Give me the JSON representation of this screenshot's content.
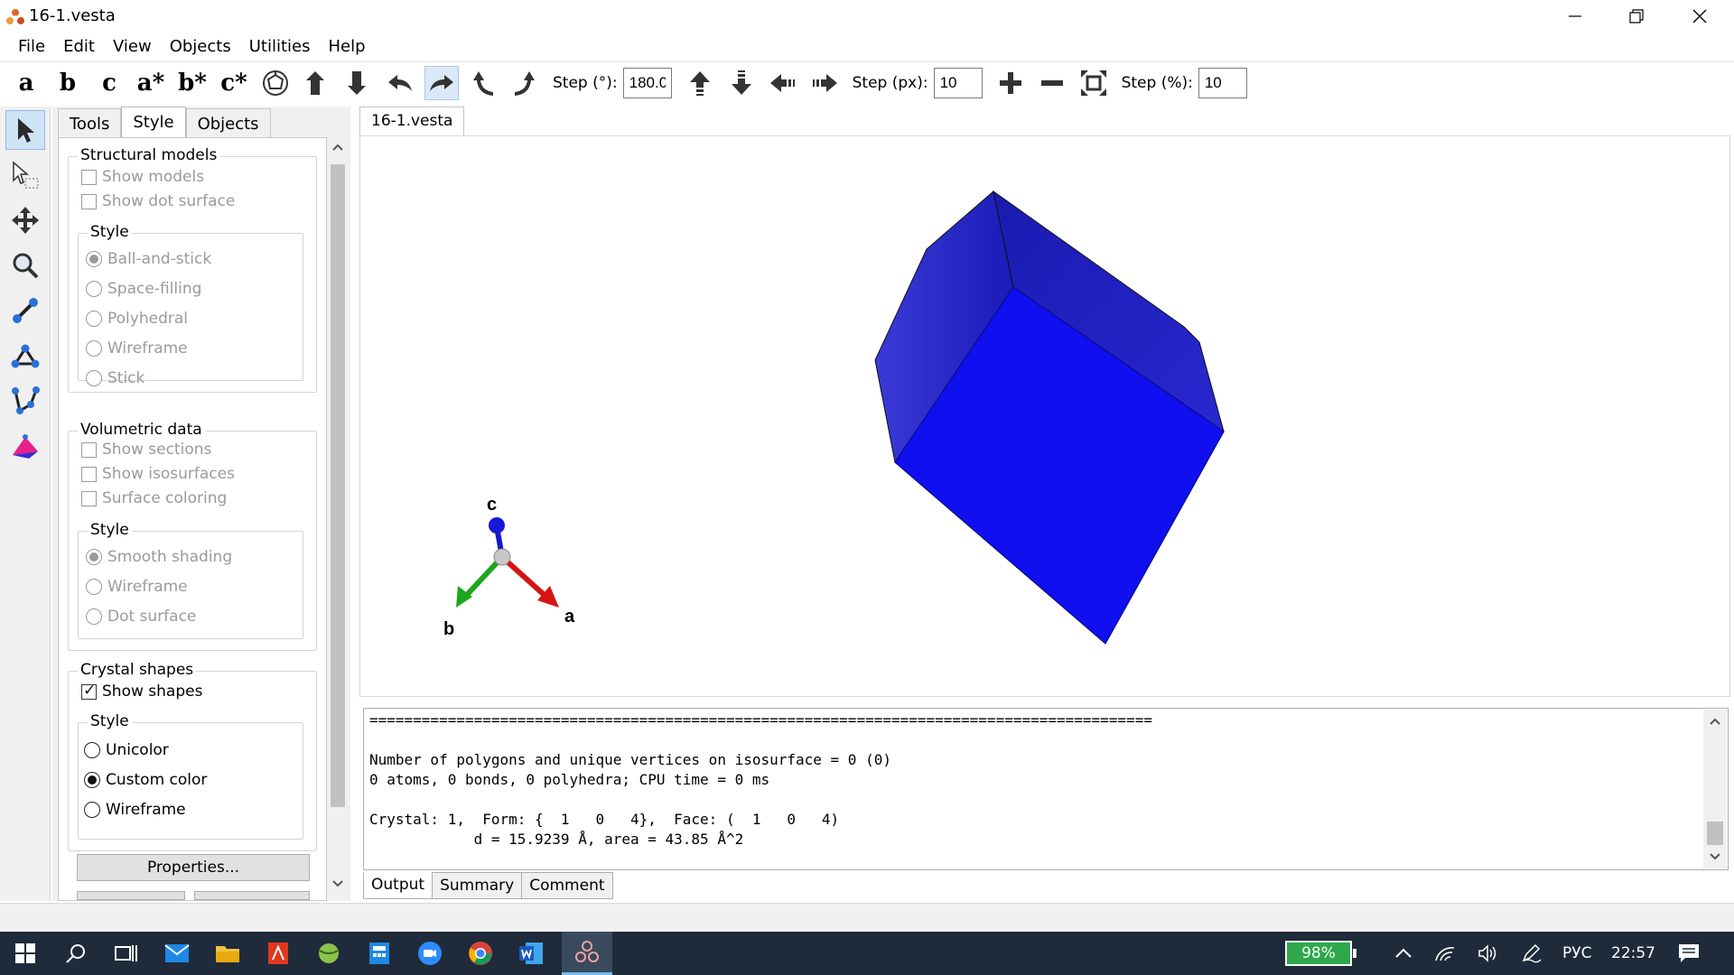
{
  "window": {
    "title": "16-1.vesta"
  },
  "menu": [
    "File",
    "Edit",
    "View",
    "Objects",
    "Utilities",
    "Help"
  ],
  "toolbar": {
    "axis_buttons": [
      "a",
      "b",
      "c",
      "a*",
      "b*",
      "c*"
    ],
    "step_deg_label": "Step (°):",
    "step_deg_value": "180.0",
    "step_px_label": "Step (px):",
    "step_px_value": "10",
    "step_pct_label": "Step (%):",
    "step_pct_value": "10"
  },
  "sidepanel": {
    "tabs": [
      "Tools",
      "Style",
      "Objects"
    ],
    "selected_tab": "Style",
    "structural": {
      "title": "Structural models",
      "show_models": "Show models",
      "show_dot_surface": "Show dot surface",
      "style_title": "Style",
      "options": [
        "Ball-and-stick",
        "Space-filling",
        "Polyhedral",
        "Wireframe",
        "Stick"
      ]
    },
    "volumetric": {
      "title": "Volumetric data",
      "show_sections": "Show sections",
      "show_isosurfaces": "Show isosurfaces",
      "surface_coloring": "Surface coloring",
      "style_title": "Style",
      "options": [
        "Smooth shading",
        "Wireframe",
        "Dot surface"
      ]
    },
    "crystal": {
      "title": "Crystal shapes",
      "show_shapes": "Show shapes",
      "style_title": "Style",
      "options": [
        "Unicolor",
        "Custom color",
        "Wireframe"
      ]
    },
    "properties_button": "Properties..."
  },
  "viewer": {
    "tab_label": "16-1.vesta",
    "axes": {
      "a": "a",
      "b": "b",
      "c": "c"
    },
    "shape_color": "#1414e6"
  },
  "output": {
    "separator": "==========================================================================================",
    "lines": [
      "Number of polygons and unique vertices on isosurface = 0 (0)",
      "0 atoms, 0 bonds, 0 polyhedra; CPU time = 0 ms",
      "",
      "Crystal: 1,  Form: {  1   0   4},  Face: (  1   0   4)",
      "            d = 15.9239 Å, area = 43.85 Å^2"
    ],
    "tabs": [
      "Output",
      "Summary",
      "Comment"
    ]
  },
  "taskbar": {
    "battery": "98%",
    "lang": "РУС",
    "time": "22:57"
  }
}
